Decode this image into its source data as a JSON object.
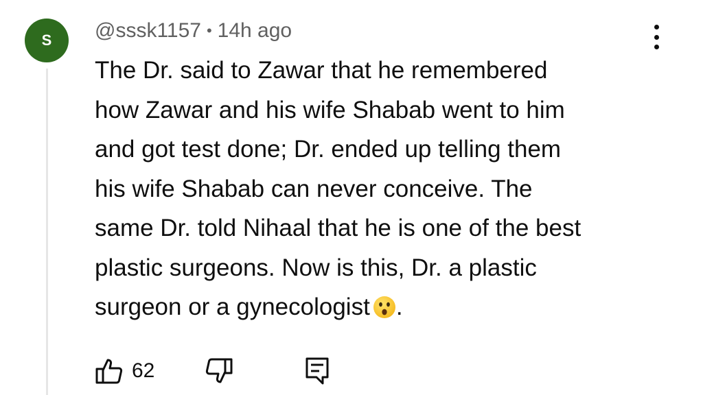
{
  "comment": {
    "avatar_letter": "S",
    "avatar_color": "#2e6b1e",
    "author": "@sssk1157",
    "separator": "•",
    "time": "14h ago",
    "lines": [
      "The Dr. said to Zawar that he remembered",
      "how Zawar and his wife Shabab went to him",
      "and got test done; Dr. ended up telling them",
      "his wife Shabab can never conceive. The",
      "same Dr. told Nihaal that he is one of the best",
      "plastic surgeons. Now is this, Dr. a plastic",
      "surgeon or a gynecologist",
      "."
    ],
    "emoji": "astonished-face-emoji",
    "likes": "62"
  },
  "icons": {
    "like": "thumbs-up-icon",
    "dislike": "thumbs-down-icon",
    "reply": "reply-comment-icon",
    "menu": "kebab-menu-icon"
  }
}
